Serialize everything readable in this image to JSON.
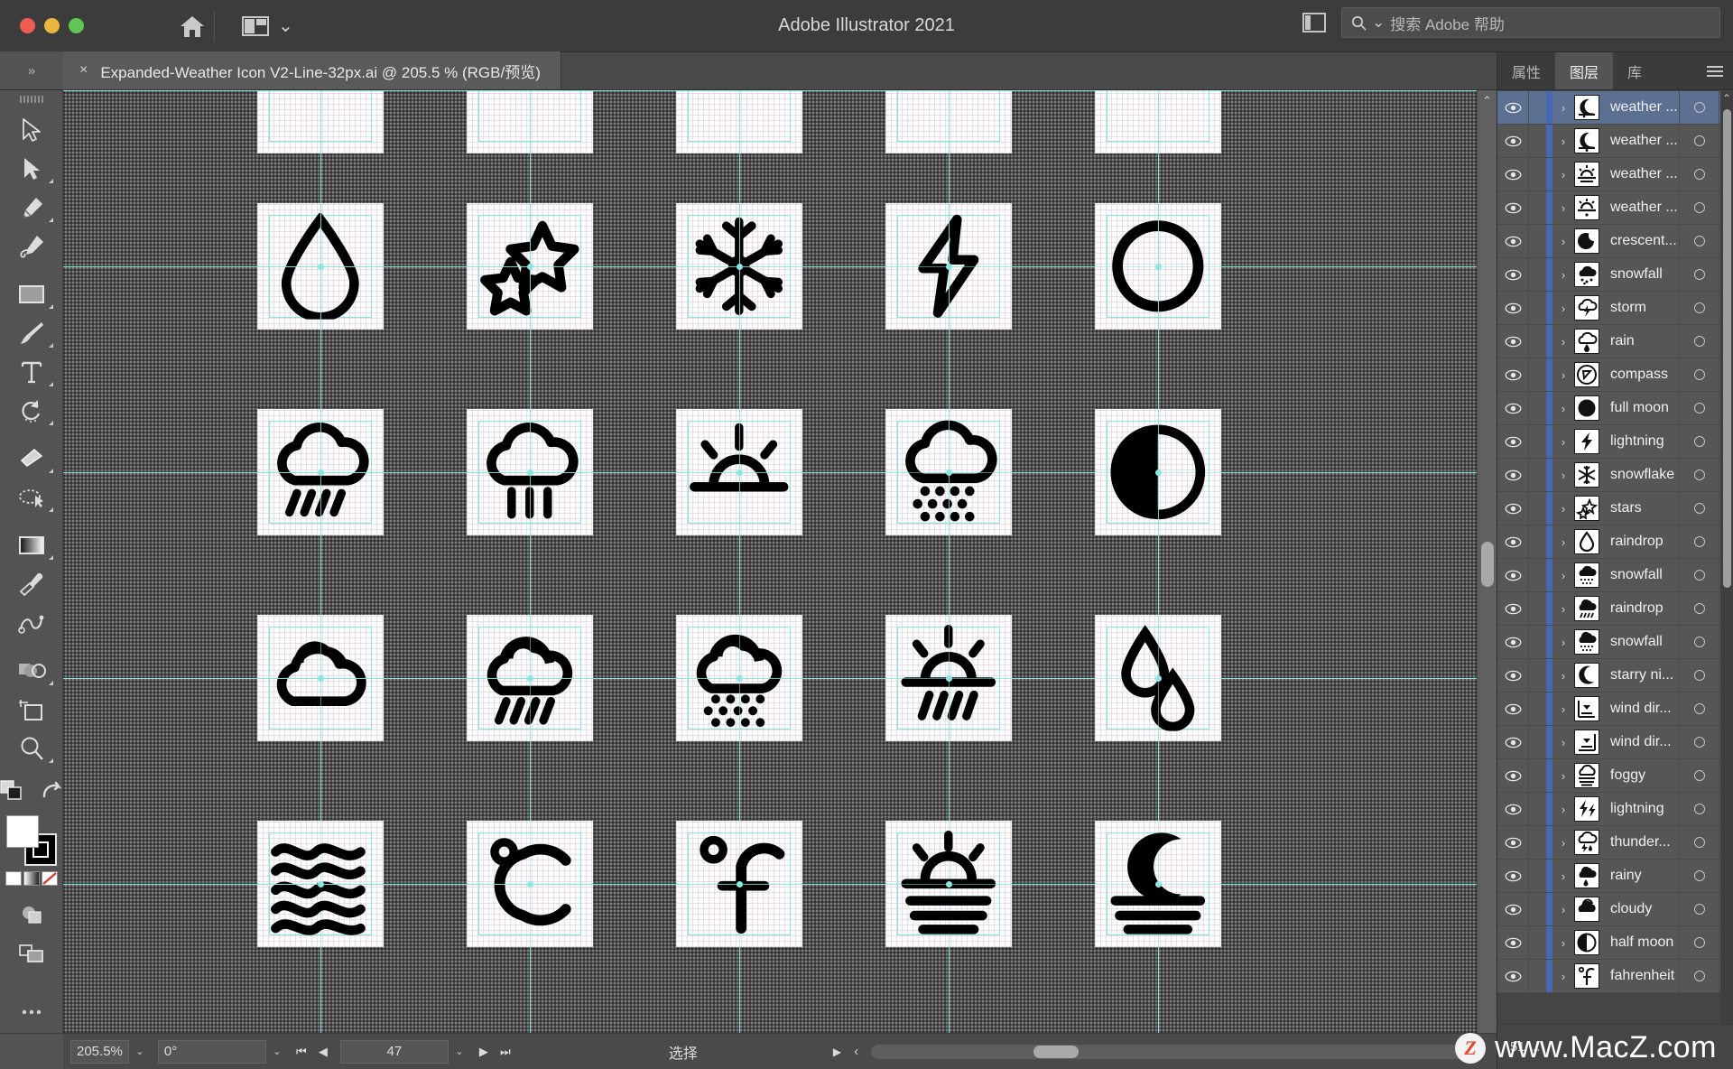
{
  "window": {
    "app_title": "Adobe Illustrator 2021",
    "traffic_lights": [
      "close",
      "minimize",
      "zoom"
    ],
    "home_icon": "home-icon",
    "arrange_icon": "arrange-documents-icon",
    "arrange_chevron": "⌄",
    "panel_toggle_icon": "panel-toggle-icon"
  },
  "search": {
    "icon": "search-icon",
    "chevron": "⌄",
    "placeholder": "搜索 Adobe 帮助"
  },
  "tabstrip": {
    "tool_chevrons": "»",
    "close_label": "×",
    "document_name": "Expanded-Weather Icon V2-Line-32px.ai @ 205.5 % (RGB/预览)",
    "right_chevron": "»"
  },
  "toolbar": {
    "tools": [
      {
        "name": "selection-tool",
        "icon": "arrow-cursor-icon",
        "corner": false
      },
      {
        "name": "direct-selection-tool",
        "icon": "filled-arrow-cursor-icon",
        "corner": true
      },
      {
        "name": "pen-tool",
        "icon": "pen-nib-icon",
        "corner": true
      },
      {
        "name": "curvature-tool",
        "icon": "curvature-pen-icon",
        "corner": false
      },
      {
        "name": "rectangle-tool",
        "icon": "rectangle-icon",
        "corner": true
      },
      {
        "name": "paintbrush-tool",
        "icon": "paintbrush-icon",
        "corner": true
      },
      {
        "name": "type-tool",
        "icon": "type-t-icon",
        "corner": true
      },
      {
        "name": "rotate-tool",
        "icon": "rotate-arrow-icon",
        "corner": true
      },
      {
        "name": "eraser-tool",
        "icon": "eraser-icon",
        "corner": true
      },
      {
        "name": "shaper-tool",
        "icon": "shaper-lasso-icon",
        "corner": true
      },
      {
        "name": "gradient-tool",
        "icon": "gradient-swatch-icon",
        "corner": true
      },
      {
        "name": "eyedropper-tool",
        "icon": "eyedropper-icon",
        "corner": false
      },
      {
        "name": "blend-tool",
        "icon": "blend-icon",
        "corner": false
      },
      {
        "name": "shape-builder-tool",
        "icon": "shape-builder-icon",
        "corner": true
      },
      {
        "name": "artboard-tool",
        "icon": "artboard-icon",
        "corner": false
      },
      {
        "name": "zoom-tool",
        "icon": "magnifier-icon",
        "corner": true
      }
    ],
    "swap_row": {
      "change_screen_icon": "change-screen-mode-icon",
      "swap_icon": "swap-fill-stroke-icon"
    },
    "color_modes": [
      "color-swatch",
      "gradient-swatch",
      "none-swatch"
    ],
    "draw_mode_icon": "draw-normal-icon",
    "screen_mode_icon": "screen-mode-icon",
    "more_icon": "more-tools-icon"
  },
  "canvas": {
    "scroll_up_icon": "⌃",
    "artboards": [
      {
        "row": 0,
        "col": 0,
        "icon": "partial-top-icon"
      },
      {
        "row": 0,
        "col": 1,
        "icon": "partial-sun-icon"
      },
      {
        "row": 0,
        "col": 2,
        "icon": "partial-moon-icon"
      },
      {
        "row": 0,
        "col": 3,
        "icon": "partial-drop-icon"
      },
      {
        "row": 0,
        "col": 4,
        "icon": "partial-rain-icon"
      },
      {
        "row": 1,
        "col": 0,
        "icon": "raindrop"
      },
      {
        "row": 1,
        "col": 1,
        "icon": "stars"
      },
      {
        "row": 1,
        "col": 2,
        "icon": "snowflake"
      },
      {
        "row": 1,
        "col": 3,
        "icon": "lightning"
      },
      {
        "row": 1,
        "col": 4,
        "icon": "full-moon-ring"
      },
      {
        "row": 2,
        "col": 0,
        "icon": "rain-cloud"
      },
      {
        "row": 2,
        "col": 1,
        "icon": "heavy-rain-cloud"
      },
      {
        "row": 2,
        "col": 2,
        "icon": "sunrise"
      },
      {
        "row": 2,
        "col": 3,
        "icon": "snowfall-cloud"
      },
      {
        "row": 2,
        "col": 4,
        "icon": "half-moon"
      },
      {
        "row": 3,
        "col": 0,
        "icon": "cloudy"
      },
      {
        "row": 3,
        "col": 1,
        "icon": "rainy-cloud-sun"
      },
      {
        "row": 3,
        "col": 2,
        "icon": "snowfall-cloud-sun"
      },
      {
        "row": 3,
        "col": 3,
        "icon": "sunrise-rain"
      },
      {
        "row": 3,
        "col": 4,
        "icon": "two-raindrops"
      },
      {
        "row": 4,
        "col": 0,
        "icon": "wind-waves"
      },
      {
        "row": 4,
        "col": 1,
        "icon": "celsius"
      },
      {
        "row": 4,
        "col": 2,
        "icon": "fahrenheit"
      },
      {
        "row": 4,
        "col": 3,
        "icon": "sunset-lines"
      },
      {
        "row": 4,
        "col": 4,
        "icon": "moon-fog"
      }
    ]
  },
  "right_panel": {
    "tabs": [
      {
        "label": "属性",
        "active": false,
        "name": "tab-properties"
      },
      {
        "label": "图层",
        "active": true,
        "name": "tab-layers"
      },
      {
        "label": "库",
        "active": false,
        "name": "tab-libraries"
      }
    ],
    "menu_icon": "panel-menu-icon",
    "layers": [
      {
        "name": "weather ...",
        "icon": "moon-cloud",
        "selected": true
      },
      {
        "name": "weather ...",
        "icon": "moon-cloud2",
        "selected": false
      },
      {
        "name": "weather ...",
        "icon": "sun-cloud",
        "selected": false
      },
      {
        "name": "weather ...",
        "icon": "sun-cloud2",
        "selected": false
      },
      {
        "name": "crescent...",
        "icon": "crescent-moon",
        "selected": false
      },
      {
        "name": "snowfall",
        "icon": "snow-cloud",
        "selected": false
      },
      {
        "name": "storm",
        "icon": "storm-cloud",
        "selected": false
      },
      {
        "name": "rain",
        "icon": "rain-cloud",
        "selected": false
      },
      {
        "name": "compass",
        "icon": "compass",
        "selected": false
      },
      {
        "name": "full moon",
        "icon": "full-moon",
        "selected": false
      },
      {
        "name": "lightning",
        "icon": "lightning-bolt",
        "selected": false
      },
      {
        "name": "snowflake",
        "icon": "snowflake",
        "selected": false
      },
      {
        "name": "stars",
        "icon": "stars",
        "selected": false
      },
      {
        "name": "raindrop",
        "icon": "raindrop",
        "selected": false
      },
      {
        "name": "snowfall",
        "icon": "snowfall-cloud",
        "selected": false
      },
      {
        "name": "raindrop",
        "icon": "raindrop-cloud",
        "selected": false
      },
      {
        "name": "snowfall",
        "icon": "snowfall-cloud-sun",
        "selected": false
      },
      {
        "name": "starry ni...",
        "icon": "starry-night",
        "selected": false
      },
      {
        "name": "wind dir...",
        "icon": "wind-direction",
        "selected": false
      },
      {
        "name": "wind dir...",
        "icon": "wind-direction2",
        "selected": false
      },
      {
        "name": "foggy",
        "icon": "foggy",
        "selected": false
      },
      {
        "name": "lightning",
        "icon": "double-lightning",
        "selected": false
      },
      {
        "name": "thunder...",
        "icon": "thunder-cloud",
        "selected": false
      },
      {
        "name": "rainy",
        "icon": "rainy-cloud",
        "selected": false
      },
      {
        "name": "cloudy",
        "icon": "cloudy",
        "selected": false
      },
      {
        "name": "half moon",
        "icon": "half-moon",
        "selected": false
      },
      {
        "name": "fahrenheit",
        "icon": "fahrenheit",
        "selected": false
      }
    ],
    "layer_count": "51 ...",
    "scroll_up_icon": "⌃",
    "scroll_down_icon": "⌄"
  },
  "statusbar": {
    "zoom_level": "205.5%",
    "zoom_chevron": "⌄",
    "rotation": "0°",
    "rotation_chevron": "⌄",
    "nav_first": "⏮",
    "nav_prev": "◀",
    "artboard_number": "47",
    "artboard_chevron": "⌄",
    "nav_next": "▶",
    "nav_last": "⏭",
    "status_text": "选择",
    "play_icon": "▶",
    "left_chevron": "‹",
    "right_chevron": "›"
  },
  "watermark": {
    "logo_letter": "Z",
    "text": "www.MacZ.com"
  }
}
